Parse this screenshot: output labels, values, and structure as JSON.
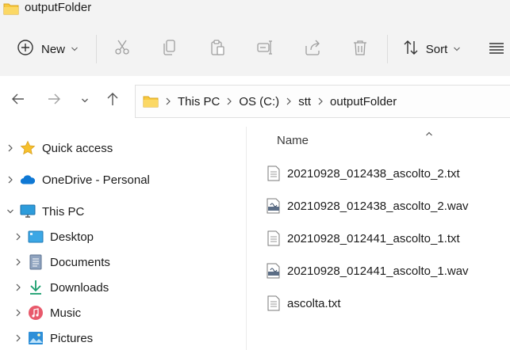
{
  "window": {
    "title": "outputFolder"
  },
  "toolbar": {
    "new_label": "New",
    "sort_label": "Sort"
  },
  "breadcrumb": [
    "This PC",
    "OS (C:)",
    "stt",
    "outputFolder"
  ],
  "sidebar": {
    "items": [
      {
        "label": "Quick access",
        "icon": "star-icon",
        "expanded": false
      },
      {
        "label": "OneDrive - Personal",
        "icon": "cloud-icon",
        "expanded": false
      },
      {
        "label": "This PC",
        "icon": "monitor-icon",
        "expanded": true
      },
      {
        "label": "Desktop",
        "icon": "desktop-icon",
        "expanded": false
      },
      {
        "label": "Documents",
        "icon": "documents-icon",
        "expanded": false
      },
      {
        "label": "Downloads",
        "icon": "download-icon",
        "expanded": false
      },
      {
        "label": "Music",
        "icon": "music-icon",
        "expanded": false
      },
      {
        "label": "Pictures",
        "icon": "pictures-icon",
        "expanded": false
      }
    ]
  },
  "files": {
    "column_name": "Name",
    "items": [
      {
        "name": "20210928_012438_ascolto_2.txt",
        "type": "txt"
      },
      {
        "name": "20210928_012438_ascolto_2.wav",
        "type": "wav"
      },
      {
        "name": "20210928_012441_ascolto_1.txt",
        "type": "txt"
      },
      {
        "name": "20210928_012441_ascolto_1.wav",
        "type": "wav"
      },
      {
        "name": "ascolta.txt",
        "type": "txt"
      }
    ]
  },
  "colors": {
    "folder": "#F8C940",
    "accent": "#0067C0",
    "toolbar_bg": "#F3F3F3",
    "disabled_icon": "#9E9E9E"
  }
}
